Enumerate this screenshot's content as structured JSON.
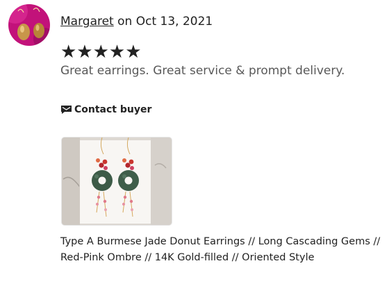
{
  "review": {
    "reviewer_name": "Margaret",
    "date_text": "on Oct 13, 2021",
    "stars_text": "★★★★★",
    "rating": 5,
    "rating_max": 5,
    "text": "Great earrings. Great service & prompt delivery."
  },
  "actions": {
    "contact_label": "Contact buyer",
    "contact_icon": "message-icon"
  },
  "listing": {
    "title": "Type A Burmese Jade Donut Earrings // Long Cascading Gems // Red-Pink Ombre // 14K Gold-filled // Oriented Style"
  },
  "colors": {
    "text": "#222222",
    "muted_text": "#595959",
    "avatar_bg": "#c2127a"
  }
}
